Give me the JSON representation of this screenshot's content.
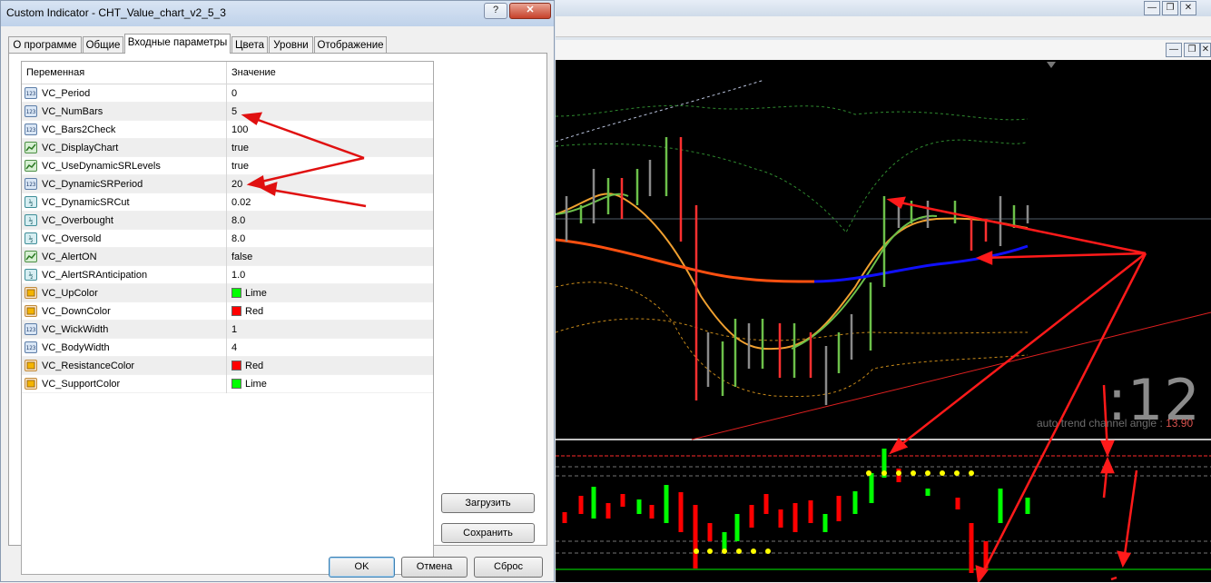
{
  "dialog": {
    "title": "Custom Indicator - CHT_Value_chart_v2_5_3",
    "help_label": "?",
    "close_label": "✕",
    "tabs": [
      {
        "label": "О программе",
        "active": false
      },
      {
        "label": "Общие",
        "active": false
      },
      {
        "label": "Входные параметры",
        "active": true
      },
      {
        "label": "Цвета",
        "active": false
      },
      {
        "label": "Уровни",
        "active": false
      },
      {
        "label": "Отображение",
        "active": false
      }
    ],
    "grid": {
      "header_variable": "Переменная",
      "header_value": "Значение",
      "rows": [
        {
          "type": "int",
          "name": "VC_Period",
          "value": "0"
        },
        {
          "type": "int",
          "name": "VC_NumBars",
          "value": "5"
        },
        {
          "type": "int",
          "name": "VC_Bars2Check",
          "value": "100"
        },
        {
          "type": "bool",
          "name": "VC_DisplayChart",
          "value": "true"
        },
        {
          "type": "bool",
          "name": "VC_UseDynamicSRLevels",
          "value": "true"
        },
        {
          "type": "int",
          "name": "VC_DynamicSRPeriod",
          "value": "20"
        },
        {
          "type": "double",
          "name": "VC_DynamicSRCut",
          "value": "0.02"
        },
        {
          "type": "double",
          "name": "VC_Overbought",
          "value": "8.0"
        },
        {
          "type": "double",
          "name": "VC_Oversold",
          "value": "8.0"
        },
        {
          "type": "bool",
          "name": "VC_AlertON",
          "value": "false"
        },
        {
          "type": "double",
          "name": "VC_AlertSRAnticipation",
          "value": "1.0"
        },
        {
          "type": "color",
          "name": "VC_UpColor",
          "value": "Lime",
          "color": "#00ff00"
        },
        {
          "type": "color",
          "name": "VC_DownColor",
          "value": "Red",
          "color": "#ff0000"
        },
        {
          "type": "int",
          "name": "VC_WickWidth",
          "value": "1"
        },
        {
          "type": "int",
          "name": "VC_BodyWidth",
          "value": "4"
        },
        {
          "type": "color",
          "name": "VC_ResistanceColor",
          "value": "Red",
          "color": "#ff0000"
        },
        {
          "type": "color",
          "name": "VC_SupportColor",
          "value": "Lime",
          "color": "#00ff00"
        }
      ]
    },
    "load_label": "Загрузить",
    "save_label": "Сохранить",
    "ok_label": "OK",
    "cancel_label": "Отмена",
    "reset_label": "Сброс"
  },
  "icons": {
    "int": "123",
    "bool": "trend-icon",
    "double": "½",
    "color": "palette-icon"
  },
  "chart": {
    "timer_text": ":12",
    "angle_label": "auto trend channel angle :",
    "angle_value": "13.90",
    "colors": {
      "background": "#000000",
      "up": "#00ff00",
      "down": "#ff0000",
      "arrow": "#ff0000",
      "sr_dots": "#ffff00"
    }
  },
  "window_controls": {
    "minimize": "—",
    "restore": "❐",
    "close": "✕"
  }
}
